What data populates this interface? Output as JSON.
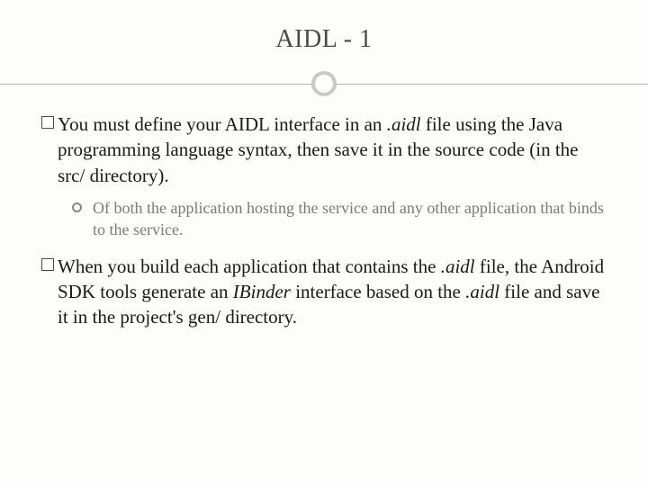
{
  "title": "AIDL - 1",
  "bullets": [
    {
      "pre": "You must define your AIDL interface in an ",
      "it1": ".aidl",
      "post": " file using the Java programming language syntax, then save it in the source code (in the src/ directory).",
      "sub": "Of both the application hosting the service and any other application that binds to the service."
    },
    {
      "pre": "When you build each application that contains the ",
      "it1": ".aidl",
      "mid1": " file, the Android SDK tools generate an ",
      "it2": "IBinder",
      "mid2": " interface based on the ",
      "it3": ".aidl",
      "post": " file and save it in the project's gen/ directory."
    }
  ]
}
